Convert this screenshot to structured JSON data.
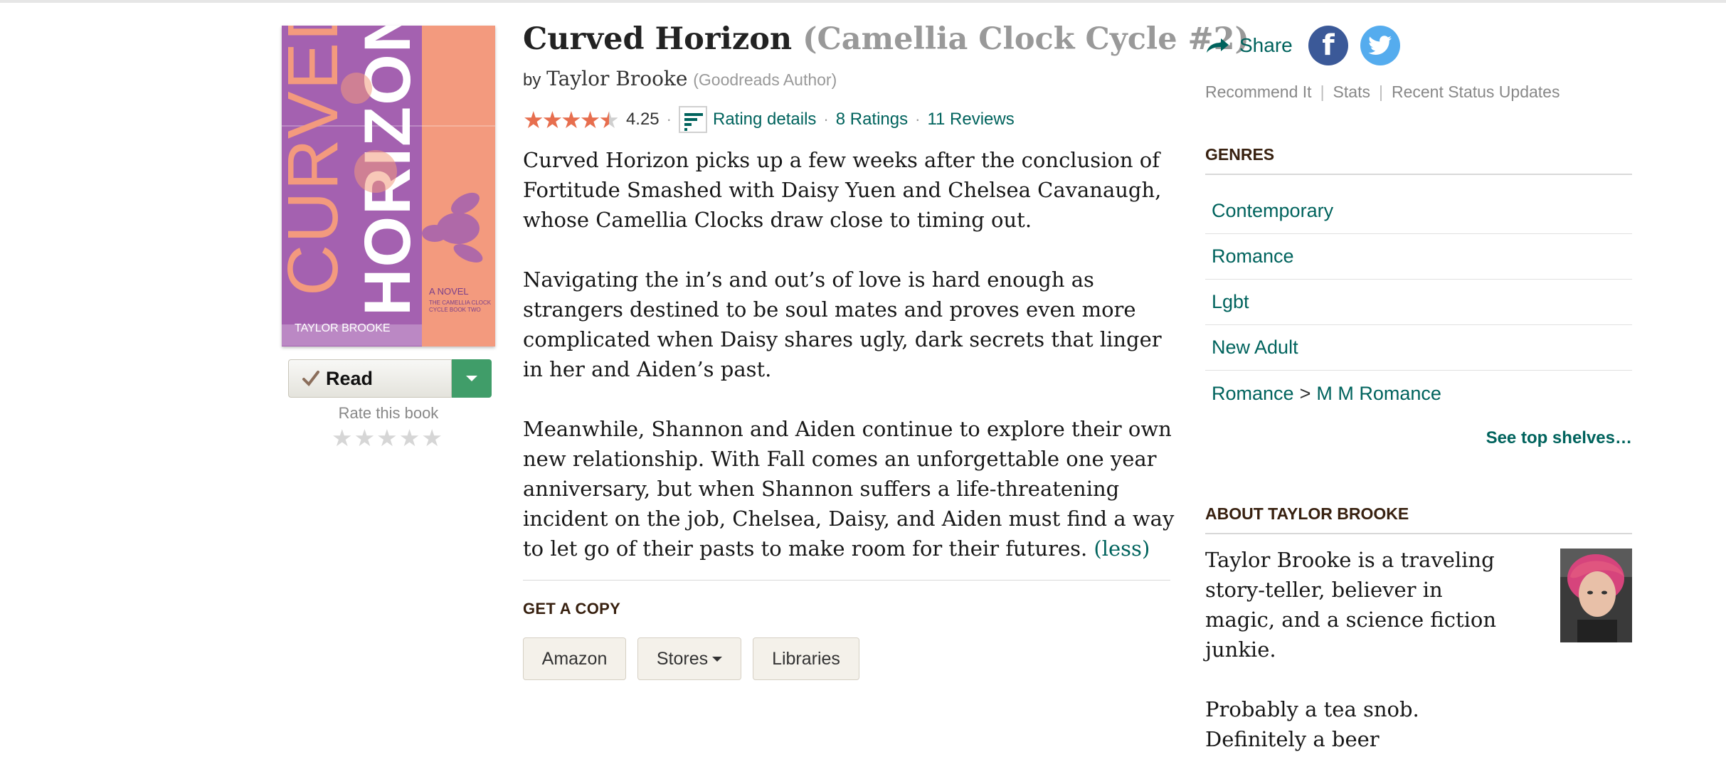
{
  "book": {
    "title": "Curved Horizon",
    "series": "(Camellia Clock Cycle #2)",
    "by": "by",
    "author": "Taylor Brooke",
    "author_role": "(Goodreads Author)",
    "cover": {
      "title_line1": "CURVED",
      "title_line2": "HORIZON",
      "tagline": "A NOVEL",
      "series_line1": "THE CAMELLIA CLOCK",
      "series_line2": "CYCLE BOOK TWO",
      "author": "TAYLOR BROOKE",
      "colors": {
        "left": "#a461b0",
        "right": "#f39a7e",
        "title": "#f39a7e",
        "title2": "#ffffff"
      }
    }
  },
  "shelf": {
    "status": "Read",
    "rate_label": "Rate this book",
    "stars": "★★★★★"
  },
  "rating": {
    "stars_full": "★★★★",
    "stars_half": "★",
    "stars_value": 4.25,
    "average": "4.25",
    "rating_details": "Rating details",
    "ratings": "8 Ratings",
    "reviews": "11 Reviews",
    "dot": "·"
  },
  "description": {
    "paragraphs": [
      "Curved Horizon picks up a few weeks after the conclusion of Fortitude Smashed with Daisy Yuen and Chelsea Cavanaugh, whose Camellia Clocks draw close to timing out.",
      "Navigating the in’s and out’s of love is hard enough as strangers destined to be soul mates and proves even more complicated when Daisy shares ugly, dark secrets that linger in her and Aiden’s past.",
      "Meanwhile, Shannon and Aiden continue to explore their own new relationship. With Fall comes an unforgettable one year anniversary, but when Shannon suffers a life-threatening incident on the job, Chelsea, Daisy, and Aiden must find a way to let go of their pasts to make room for their futures."
    ],
    "less": "(less)"
  },
  "get_copy": {
    "heading": "GET A COPY",
    "buttons": [
      "Amazon",
      "Stores",
      "Libraries"
    ]
  },
  "sidebar": {
    "share": "Share",
    "facebook_letter": "f",
    "links": [
      "Recommend It",
      "Stats",
      "Recent Status Updates"
    ],
    "sep": "|",
    "genres_heading": "GENRES",
    "genres": [
      "Contemporary",
      "Romance",
      "Lgbt",
      "New Adult"
    ],
    "genre_path": {
      "parent": "Romance",
      "arrow": ">",
      "child": "M M Romance"
    },
    "see_top": "See top shelves…",
    "about_heading": "ABOUT TAYLOR BROOKE",
    "about_paragraphs": [
      "Taylor Brooke is a traveling story-teller, believer in magic, and a science fiction junkie.",
      "Probably a tea snob. Definitely a beer"
    ]
  },
  "colors": {
    "link": "#00635d",
    "star": "#e76e4e",
    "heading": "#382110",
    "read_green": "#409d69"
  }
}
